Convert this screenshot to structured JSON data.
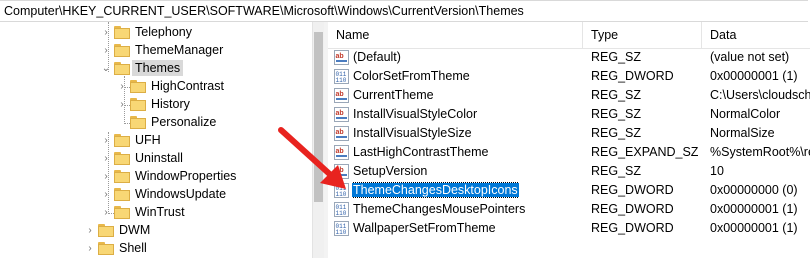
{
  "address_bar": {
    "path": "Computer\\HKEY_CURRENT_USER\\SOFTWARE\\Microsoft\\Windows\\CurrentVersion\\Themes"
  },
  "tree": {
    "items": [
      {
        "label": "Telephony"
      },
      {
        "label": "ThemeManager"
      },
      {
        "label": "Themes"
      },
      {
        "label": "HighContrast"
      },
      {
        "label": "History"
      },
      {
        "label": "Personalize"
      },
      {
        "label": "UFH"
      },
      {
        "label": "Uninstall"
      },
      {
        "label": "WindowProperties"
      },
      {
        "label": "WindowsUpdate"
      },
      {
        "label": "WinTrust"
      },
      {
        "label": "DWM"
      },
      {
        "label": "Shell"
      }
    ]
  },
  "columns": {
    "name": "Name",
    "type": "Type",
    "data": "Data"
  },
  "values": [
    {
      "name": "(Default)",
      "type": "REG_SZ",
      "data": "(value not set)",
      "kind": "string"
    },
    {
      "name": "ColorSetFromTheme",
      "type": "REG_DWORD",
      "data": "0x00000001 (1)",
      "kind": "binary"
    },
    {
      "name": "CurrentTheme",
      "type": "REG_SZ",
      "data": "C:\\Users\\cloudscho",
      "kind": "string"
    },
    {
      "name": "InstallVisualStyleColor",
      "type": "REG_SZ",
      "data": "NormalColor",
      "kind": "string"
    },
    {
      "name": "InstallVisualStyleSize",
      "type": "REG_SZ",
      "data": "NormalSize",
      "kind": "string"
    },
    {
      "name": "LastHighContrastTheme",
      "type": "REG_EXPAND_SZ",
      "data": "%SystemRoot%\\res",
      "kind": "string"
    },
    {
      "name": "SetupVersion",
      "type": "REG_SZ",
      "data": "10",
      "kind": "string"
    },
    {
      "name": "ThemeChangesDesktopIcons",
      "type": "REG_DWORD",
      "data": "0x00000000 (0)",
      "kind": "binary"
    },
    {
      "name": "ThemeChangesMousePointers",
      "type": "REG_DWORD",
      "data": "0x00000001 (1)",
      "kind": "binary"
    },
    {
      "name": "WallpaperSetFromTheme",
      "type": "REG_DWORD",
      "data": "0x00000001 (1)",
      "kind": "binary"
    }
  ],
  "colors": {
    "selection": "#0078d7",
    "arrow": "#e8231f",
    "folder": "#f8d775"
  }
}
